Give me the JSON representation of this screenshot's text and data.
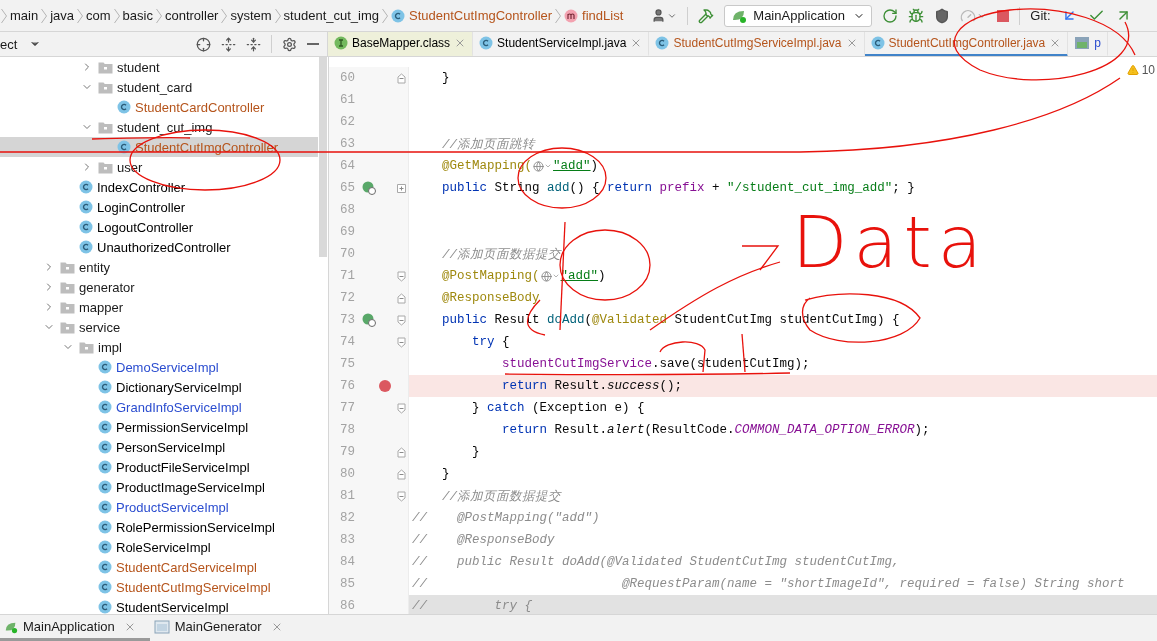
{
  "breadcrumbs": [
    {
      "label": "main",
      "kind": "folder"
    },
    {
      "label": "java",
      "kind": "folder"
    },
    {
      "label": "com",
      "kind": "folder"
    },
    {
      "label": "basic",
      "kind": "folder"
    },
    {
      "label": "controller",
      "kind": "folder"
    },
    {
      "label": "system",
      "kind": "folder"
    },
    {
      "label": "student_cut_img",
      "kind": "folder"
    },
    {
      "label": "StudentCutImgController",
      "kind": "class",
      "color": "#b5541b"
    },
    {
      "label": "findList",
      "kind": "method",
      "color": "#b5541b"
    }
  ],
  "toolbar": {
    "run_config": "MainApplication",
    "git_label": "Git:"
  },
  "project_panel": {
    "view_label": "ect"
  },
  "editor_tabs": [
    {
      "label": "BaseMapper.class",
      "kind": "interface",
      "selected": false,
      "color": "#000000",
      "library": true
    },
    {
      "label": "StudentServiceImpl.java",
      "kind": "class",
      "selected": false,
      "color": "#000000",
      "library": false
    },
    {
      "label": "StudentCutImgServiceImpl.java",
      "kind": "class",
      "selected": false,
      "color": "#b5541b",
      "library": false
    },
    {
      "label": "StudentCutImgController.java",
      "kind": "class",
      "selected": true,
      "color": "#b5541b",
      "library": false
    },
    {
      "label": "p",
      "kind": "module",
      "selected": false,
      "color": "#2a4ccf",
      "library": false
    }
  ],
  "tree": [
    {
      "children": [
        {
          "children": [
            {
              "label": "student",
              "kind": "folder",
              "expanded": false,
              "selected": false
            },
            {
              "label": "student_card",
              "kind": "folder",
              "expanded": true,
              "selected": false,
              "children": [
                {
                  "label": "StudentCardController",
                  "kind": "class",
                  "color": "#b5541b",
                  "selected": false
                }
              ]
            },
            {
              "label": "student_cut_img",
              "kind": "folder",
              "expanded": true,
              "selected": false,
              "children": [
                {
                  "label": "StudentCutImgController",
                  "kind": "class",
                  "color": "#b5541b",
                  "selected": true
                }
              ]
            },
            {
              "label": "user",
              "kind": "folder",
              "expanded": false,
              "selected": false
            }
          ]
        },
        {
          "label": "IndexController",
          "kind": "class",
          "color": "#000000",
          "selected": false
        },
        {
          "label": "LoginController",
          "kind": "class",
          "color": "#000000",
          "selected": false
        },
        {
          "label": "LogoutController",
          "kind": "class",
          "color": "#000000",
          "selected": false
        },
        {
          "label": "UnauthorizedController",
          "kind": "class",
          "color": "#000000",
          "selected": false
        }
      ]
    },
    {
      "label": "entity",
      "kind": "folder",
      "expanded": false,
      "selected": false
    },
    {
      "label": "generator",
      "kind": "folder",
      "expanded": false,
      "selected": false
    },
    {
      "label": "mapper",
      "kind": "folder",
      "expanded": false,
      "selected": false
    },
    {
      "label": "service",
      "kind": "folder",
      "expanded": true,
      "selected": false,
      "children": [
        {
          "label": "impl",
          "kind": "folder",
          "expanded": true,
          "selected": false,
          "children": [
            {
              "label": "DemoServiceImpl",
              "kind": "class",
              "color": "#2a4ccf",
              "selected": false
            },
            {
              "label": "DictionaryServiceImpl",
              "kind": "class",
              "color": "#000000",
              "selected": false
            },
            {
              "label": "GrandInfoServiceImpl",
              "kind": "class",
              "color": "#2a4ccf",
              "selected": false
            },
            {
              "label": "PermissionServiceImpl",
              "kind": "class",
              "color": "#000000",
              "selected": false
            },
            {
              "label": "PersonServiceImpl",
              "kind": "class",
              "color": "#000000",
              "selected": false
            },
            {
              "label": "ProductFileServiceImpl",
              "kind": "class",
              "color": "#000000",
              "selected": false
            },
            {
              "label": "ProductImageServiceImpl",
              "kind": "class",
              "color": "#000000",
              "selected": false
            },
            {
              "label": "ProductServiceImpl",
              "kind": "class",
              "color": "#2a4ccf",
              "selected": false
            },
            {
              "label": "RolePermissionServiceImpl",
              "kind": "class",
              "color": "#000000",
              "selected": false
            },
            {
              "label": "RoleServiceImpl",
              "kind": "class",
              "color": "#000000",
              "selected": false
            },
            {
              "label": "StudentCardServiceImpl",
              "kind": "class",
              "color": "#b5541b",
              "selected": false
            },
            {
              "label": "StudentCutImgServiceImpl",
              "kind": "class",
              "color": "#b5541b",
              "selected": false
            },
            {
              "label": "StudentServiceImpl",
              "kind": "class",
              "color": "#000000",
              "selected": false
            }
          ]
        }
      ]
    }
  ],
  "editor": {
    "warning_count": "10",
    "lines": [
      {
        "number": "60",
        "fold_end": true,
        "tokens": [
          {
            "t": "    }",
            "kind": "plain"
          }
        ]
      },
      {
        "number": "61"
      },
      {
        "number": "62"
      },
      {
        "number": "63",
        "tokens": [
          {
            "t": "    //添加页面跳转",
            "kind": "cm"
          }
        ]
      },
      {
        "number": "64",
        "tokens": [
          {
            "t": "    @GetMapping(",
            "kind": "ann"
          },
          {
            "kind": "inlay"
          },
          {
            "t": "\"add\"",
            "kind": "link"
          },
          {
            "t": ")",
            "kind": "plain"
          }
        ]
      },
      {
        "number": "65",
        "run": true,
        "folded": true,
        "tokens": [
          {
            "t": "    public ",
            "kind": "kw"
          },
          {
            "t": "String ",
            "kind": "plain"
          },
          {
            "t": "add",
            "kind": "fn"
          },
          {
            "t": "() { ",
            "kind": "plain"
          },
          {
            "t": "return ",
            "kind": "kw"
          },
          {
            "t": "prefix",
            "kind": "fld"
          },
          {
            "t": " + ",
            "kind": "plain"
          },
          {
            "t": "\"/student_cut_img_add\"",
            "kind": "str"
          },
          {
            "t": "; }",
            "kind": "plain"
          }
        ]
      },
      {
        "number": "68"
      },
      {
        "number": "69"
      },
      {
        "number": "70",
        "tokens": [
          {
            "t": "    //添加页面数据提交",
            "kind": "cm"
          }
        ]
      },
      {
        "number": "71",
        "fold_start": true,
        "tokens": [
          {
            "t": "    @PostMapping(",
            "kind": "ann"
          },
          {
            "kind": "inlay"
          },
          {
            "t": "\"add\"",
            "kind": "link"
          },
          {
            "t": ")",
            "kind": "plain"
          }
        ]
      },
      {
        "number": "72",
        "fold_end": true,
        "tokens": [
          {
            "t": "    @ResponseBody",
            "kind": "ann"
          }
        ]
      },
      {
        "number": "73",
        "run": true,
        "fold_start": true,
        "tokens": [
          {
            "t": "    public ",
            "kind": "kw"
          },
          {
            "t": "Result ",
            "kind": "plain"
          },
          {
            "t": "doAdd",
            "kind": "fn"
          },
          {
            "t": "(",
            "kind": "plain"
          },
          {
            "t": "@Validated",
            "kind": "ann"
          },
          {
            "t": " StudentCutImg studentCutImg) {",
            "kind": "plain"
          }
        ]
      },
      {
        "number": "74",
        "fold_start": true,
        "tokens": [
          {
            "t": "        try",
            "kind": "kw"
          },
          {
            "t": " {",
            "kind": "plain"
          }
        ]
      },
      {
        "number": "75",
        "tokens": [
          {
            "t": "            studentCutImgService",
            "kind": "fld"
          },
          {
            "t": ".save(studentCutImg);",
            "kind": "plain"
          }
        ]
      },
      {
        "number": "76",
        "breakpoint": true,
        "tokens": [
          {
            "t": "            return ",
            "kind": "kw"
          },
          {
            "t": "Result.",
            "kind": "plain"
          },
          {
            "t": "success",
            "kind": "ital"
          },
          {
            "t": "();",
            "kind": "plain"
          }
        ]
      },
      {
        "number": "77",
        "fold_start": true,
        "tokens": [
          {
            "t": "        } ",
            "kind": "plain"
          },
          {
            "t": "catch",
            "kind": "kw"
          },
          {
            "t": " (Exception e) {",
            "kind": "plain"
          }
        ]
      },
      {
        "number": "78",
        "tokens": [
          {
            "t": "            return ",
            "kind": "kw"
          },
          {
            "t": "Result.",
            "kind": "plain"
          },
          {
            "t": "alert",
            "kind": "ital"
          },
          {
            "t": "(ResultCode.",
            "kind": "plain"
          },
          {
            "t": "COMMON_DATA_OPTION_ERROR",
            "kind": "const"
          },
          {
            "t": ");",
            "kind": "plain"
          }
        ]
      },
      {
        "number": "79",
        "fold_end": true,
        "tokens": [
          {
            "t": "        }",
            "kind": "plain"
          }
        ]
      },
      {
        "number": "80",
        "fold_end": true,
        "tokens": [
          {
            "t": "    }",
            "kind": "plain"
          }
        ]
      },
      {
        "number": "81",
        "fold_start": true,
        "tokens": [
          {
            "t": "    //添加页面数据提交",
            "kind": "cm"
          }
        ]
      },
      {
        "number": "82",
        "tokens": [
          {
            "t": "//    @PostMapping(\"add\")",
            "kind": "cm"
          }
        ]
      },
      {
        "number": "83",
        "tokens": [
          {
            "t": "//    @ResponseBody",
            "kind": "cm"
          }
        ]
      },
      {
        "number": "84",
        "tokens": [
          {
            "t": "//    public Result doAdd(@Validated StudentCutImg studentCutImg,",
            "kind": "cm"
          }
        ]
      },
      {
        "number": "85",
        "tokens": [
          {
            "t": "//                          @RequestParam(name = \"shortImageId\", required = false) String short",
            "kind": "cm"
          }
        ]
      },
      {
        "number": "86",
        "current": true,
        "tokens": [
          {
            "t": "//         try {",
            "kind": "cm"
          }
        ]
      }
    ]
  },
  "annotation": {
    "note": "Data"
  },
  "bottom_tabs": [
    {
      "label": "MainApplication",
      "kind": "run",
      "selected": true
    },
    {
      "label": "MainGenerator",
      "kind": "app",
      "selected": false
    }
  ]
}
